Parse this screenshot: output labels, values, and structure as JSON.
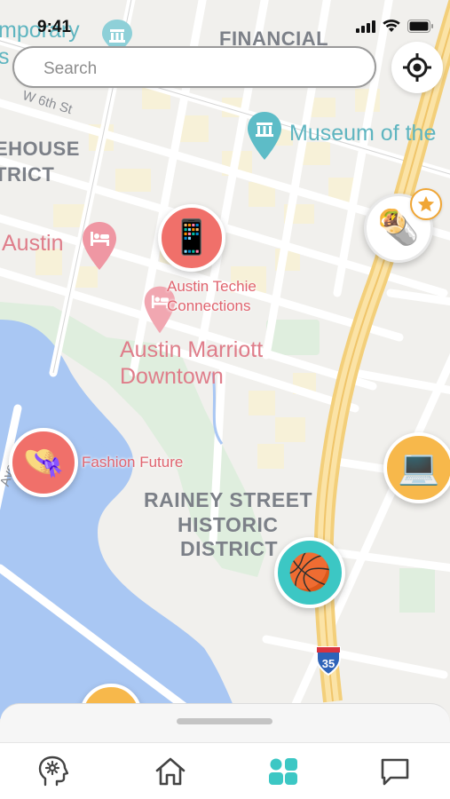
{
  "status_bar": {
    "time": "9:41"
  },
  "search": {
    "placeholder": "Search"
  },
  "map": {
    "labels": {
      "contemporary": "mporary",
      "contemporary_line2": "s",
      "financial": "FINANCIAL",
      "w6th": "W 6th St",
      "warehouse_1": "EHOUSE",
      "warehouse_2": "TRICT",
      "museum": "Museum of the",
      "austin_hotel": "Austin",
      "austin_techie_1": "Austin Techie",
      "austin_techie_2": "Connections",
      "marriott_1": "Austin Marriott",
      "marriott_2": "Downtown",
      "rainey_1": "RAINEY STREET",
      "rainey_2": "HISTORIC",
      "rainey_3": "DISTRICT",
      "ave": "Ave",
      "interstate": "35"
    },
    "markers": {
      "phone": {
        "emoji": "📱"
      },
      "burrito": {
        "emoji": "🌯"
      },
      "fashion": {
        "emoji": "👒",
        "label": "Fashion Future"
      },
      "laptop": {
        "emoji": "💻"
      },
      "basketball": {
        "emoji": "🏀"
      }
    }
  },
  "colors": {
    "accent_teal": "#3cc7c4",
    "marker_red": "#f0706a",
    "marker_orange": "#f7b84b",
    "star": "#f0a635"
  },
  "tabs": [
    {
      "name": "settings-head",
      "icon": "head-gear-icon"
    },
    {
      "name": "home",
      "icon": "home-icon"
    },
    {
      "name": "groups",
      "icon": "grid-people-icon",
      "active": true
    },
    {
      "name": "messages",
      "icon": "chat-icon"
    }
  ]
}
